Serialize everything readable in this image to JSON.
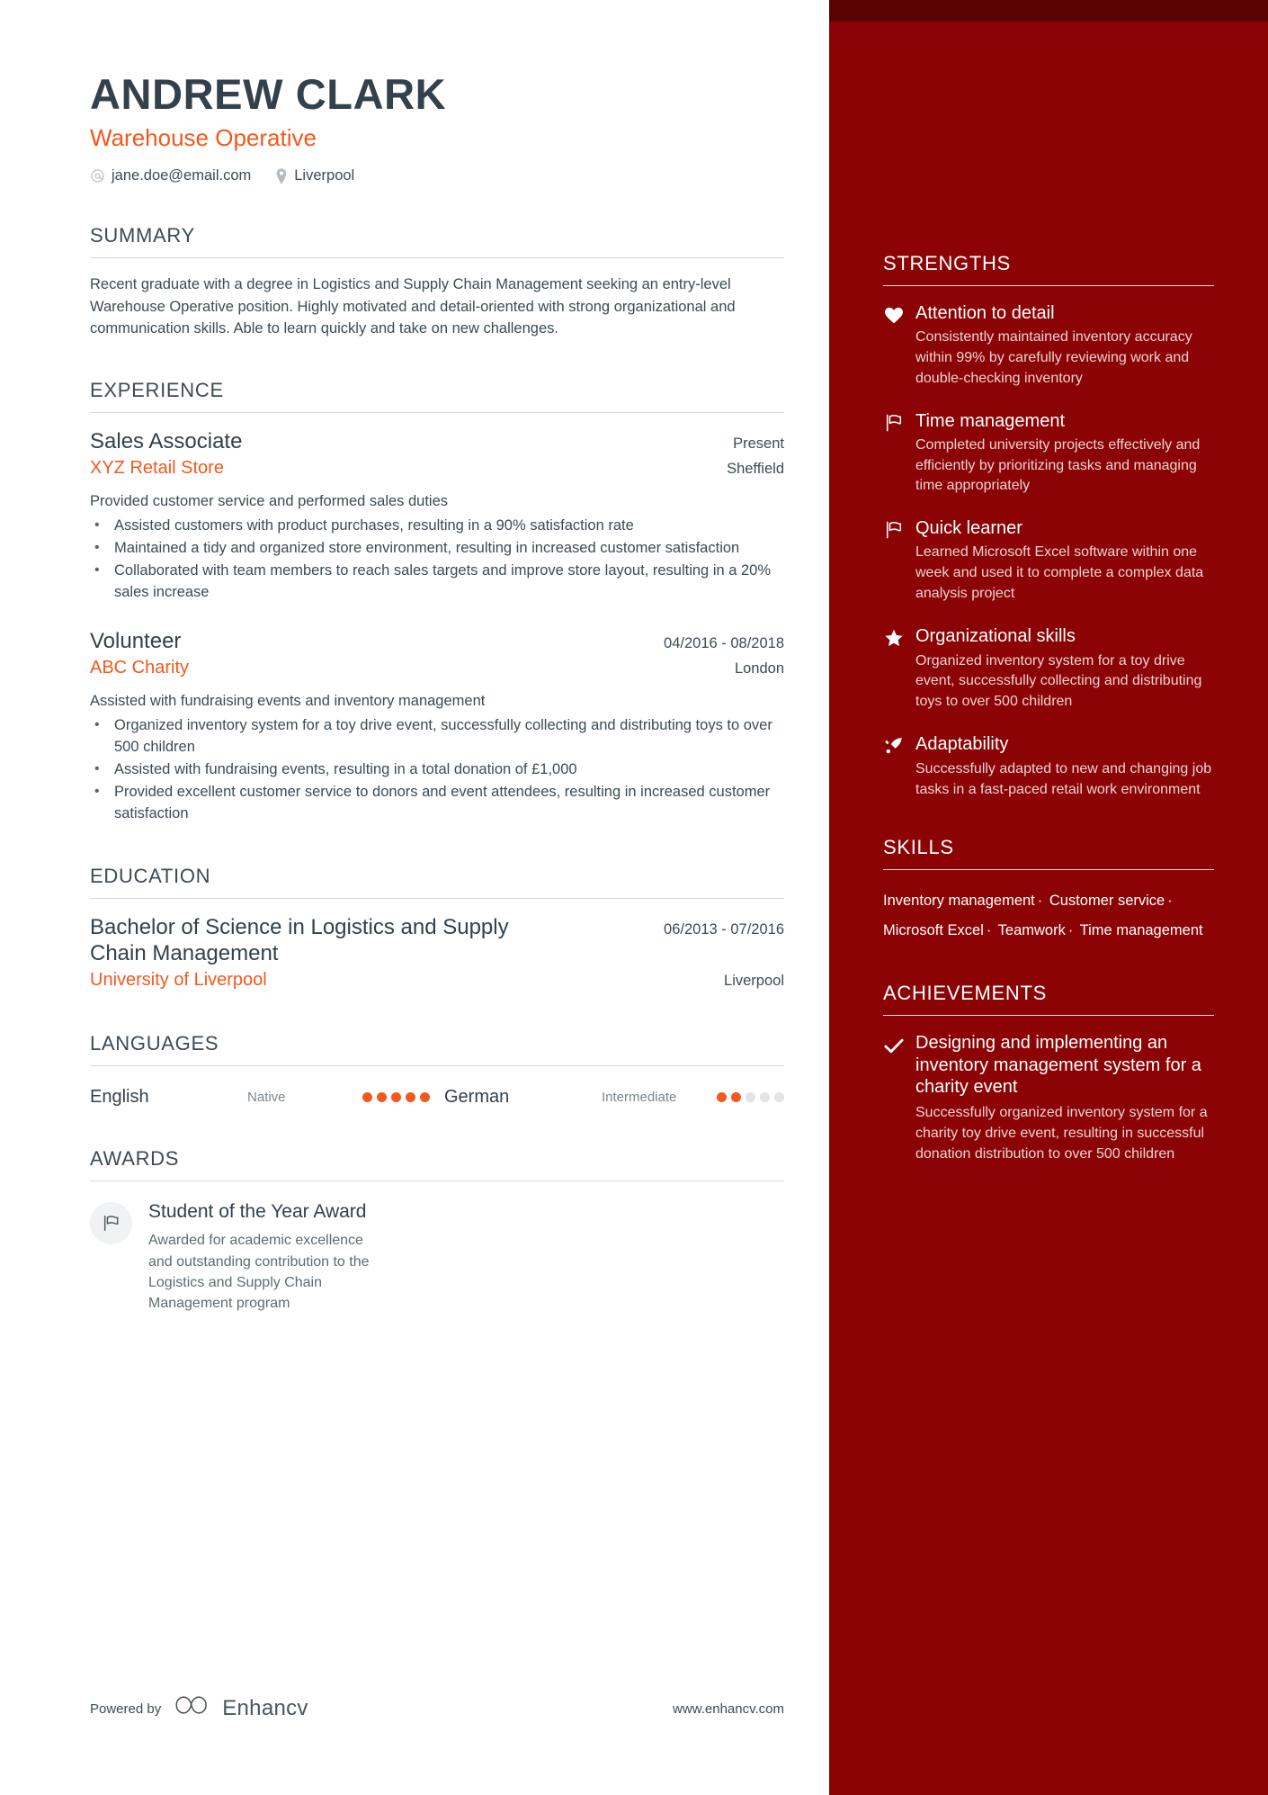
{
  "theme": {
    "sidebar_bg": "#8b0304",
    "sidebar_top_strip": "#5b0202",
    "accent": "#f4581c",
    "heading": "#32414b",
    "body_text": "#3c4b55"
  },
  "header": {
    "name": "ANDREW CLARK",
    "role": "Warehouse Operative",
    "email": "jane.doe@email.com",
    "location": "Liverpool",
    "email_icon": "at-icon",
    "location_icon": "map-pin-icon"
  },
  "summary": {
    "title": "SUMMARY",
    "text": "Recent graduate with a degree in Logistics and Supply Chain Management seeking an entry-level Warehouse Operative position. Highly motivated and detail-oriented with strong organizational and communication skills. Able to learn quickly and take on new challenges."
  },
  "experience": {
    "title": "EXPERIENCE",
    "entries": [
      {
        "role": "Sales Associate",
        "date": "Present",
        "company": "XYZ Retail Store",
        "location": "Sheffield",
        "description": "Provided customer service and performed sales duties",
        "bullets": [
          "Assisted customers with product purchases, resulting in a 90% satisfaction rate",
          "Maintained a tidy and organized store environment, resulting in increased customer satisfaction",
          "Collaborated with team members to reach sales targets and improve store layout, resulting in a 20% sales increase"
        ]
      },
      {
        "role": "Volunteer",
        "date": "04/2016 - 08/2018",
        "company": "ABC Charity",
        "location": "London",
        "description": "Assisted with fundraising events and inventory management",
        "bullets": [
          "Organized inventory system for a toy drive event, successfully collecting and distributing toys to over 500 children",
          "Assisted with fundraising events, resulting in a total donation of £1,000",
          "Provided excellent customer service to donors and event attendees, resulting in increased customer satisfaction"
        ]
      }
    ]
  },
  "education": {
    "title": "EDUCATION",
    "entries": [
      {
        "degree": "Bachelor of Science in Logistics and Supply Chain Management",
        "date": "06/2013 - 07/2016",
        "school": "University of Liverpool",
        "location": "Liverpool"
      }
    ]
  },
  "languages": {
    "title": "LANGUAGES",
    "items": [
      {
        "name": "English",
        "level": "Native",
        "filled": 5,
        "total": 5
      },
      {
        "name": "German",
        "level": "Intermediate",
        "filled": 2,
        "total": 5
      }
    ]
  },
  "awards": {
    "title": "AWARDS",
    "items": [
      {
        "icon": "flag-icon",
        "title": "Student of the Year Award",
        "description": "Awarded for academic excellence and outstanding contribution to the Logistics and Supply Chain Management program"
      }
    ]
  },
  "strengths": {
    "title": "STRENGTHS",
    "items": [
      {
        "icon": "heart-icon",
        "name": "Attention to detail",
        "description": "Consistently maintained inventory accuracy within 99% by carefully reviewing work and double-checking inventory"
      },
      {
        "icon": "flag-icon",
        "name": "Time management",
        "description": "Completed university projects effectively and efficiently by prioritizing tasks and managing time appropriately"
      },
      {
        "icon": "flag-icon",
        "name": "Quick learner",
        "description": "Learned Microsoft Excel software within one week and used it to complete a complex data analysis project"
      },
      {
        "icon": "star-icon",
        "name": "Organizational skills",
        "description": "Organized inventory system for a toy drive event, successfully collecting and distributing toys to over 500 children"
      },
      {
        "icon": "rocket-icon",
        "name": "Adaptability",
        "description": "Successfully adapted to new and changing job tasks in a fast-paced retail work environment"
      }
    ]
  },
  "skills": {
    "title": "SKILLS",
    "separator": "·",
    "items": [
      "Inventory management",
      "Customer service",
      "Microsoft Excel",
      "Teamwork",
      "Time management"
    ]
  },
  "achievements": {
    "title": "ACHIEVEMENTS",
    "items": [
      {
        "icon": "check-icon",
        "title": "Designing and implementing an inventory management system for a charity event",
        "description": "Successfully organized inventory system for a charity toy drive event, resulting in successful donation distribution to over 500 children"
      }
    ]
  },
  "footer": {
    "powered_by": "Powered by",
    "brand": "Enhancv",
    "website": "www.enhancv.com"
  }
}
